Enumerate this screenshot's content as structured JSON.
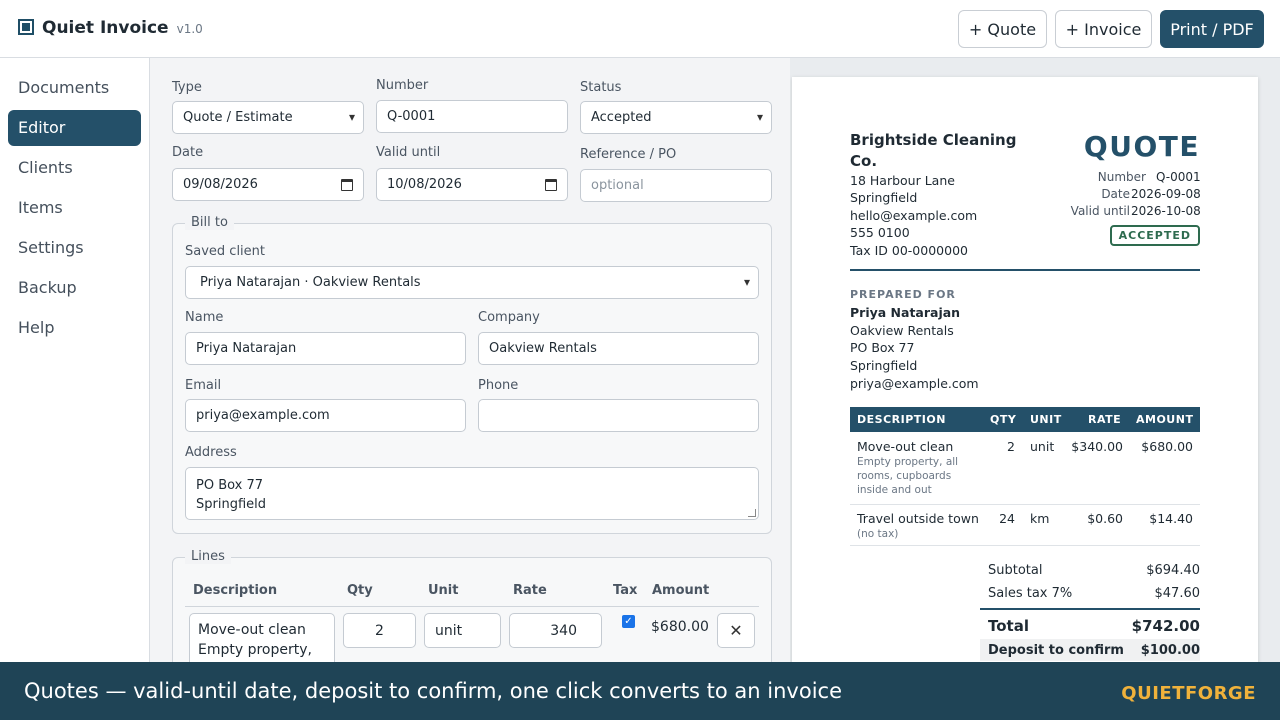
{
  "app": {
    "title": "Quiet Invoice",
    "version": "v1.0"
  },
  "header": {
    "new_quote": "+ Quote",
    "new_invoice": "+ Invoice",
    "print": "Print / PDF"
  },
  "sidebar": {
    "items": [
      {
        "label": "Documents",
        "active": false
      },
      {
        "label": "Editor",
        "active": true
      },
      {
        "label": "Clients",
        "active": false
      },
      {
        "label": "Items",
        "active": false
      },
      {
        "label": "Settings",
        "active": false
      },
      {
        "label": "Backup",
        "active": false
      },
      {
        "label": "Help",
        "active": false
      }
    ]
  },
  "editor": {
    "type_label": "Type",
    "type_value": "Quote / Estimate",
    "number_label": "Number",
    "number_value": "Q-0001",
    "status_label": "Status",
    "status_value": "Accepted",
    "date_label": "Date",
    "date_value": "09/08/2026",
    "valid_label": "Valid until",
    "valid_value": "10/08/2026",
    "ref_label": "Reference / PO",
    "ref_placeholder": "optional",
    "bill_to": {
      "legend": "Bill to",
      "saved_label": "Saved client",
      "saved_value": "Priya Natarajan · Oakview Rentals",
      "name_label": "Name",
      "name_value": "Priya Natarajan",
      "company_label": "Company",
      "company_value": "Oakview Rentals",
      "email_label": "Email",
      "email_value": "priya@example.com",
      "phone_label": "Phone",
      "phone_value": "",
      "address_label": "Address",
      "address_line1": "PO Box 77",
      "address_line2": "Springfield"
    },
    "lines": {
      "legend": "Lines",
      "columns": [
        "Description",
        "Qty",
        "Unit",
        "Rate",
        "Tax",
        "Amount"
      ],
      "rows": [
        {
          "desc1": "Move-out clean",
          "desc2": "Empty property,",
          "qty": "2",
          "unit": "unit",
          "rate": "340",
          "taxed": true,
          "amount": "$680.00"
        }
      ]
    }
  },
  "preview": {
    "company": "Brightside Cleaning Co.",
    "company_lines": [
      "18 Harbour Lane",
      "Springfield",
      "hello@example.com",
      "555 0100",
      "Tax ID 00-0000000"
    ],
    "doc_title": "QUOTE",
    "meta": [
      {
        "label": "Number",
        "value": "Q-0001"
      },
      {
        "label": "Date",
        "value": "2026-09-08"
      },
      {
        "label": "Valid until",
        "value": "2026-10-08"
      }
    ],
    "badge": "ACCEPTED",
    "prepared_for_label": "PREPARED FOR",
    "client_name": "Priya Natarajan",
    "client_lines": [
      "Oakview Rentals",
      "PO Box 77",
      "Springfield",
      "priya@example.com"
    ],
    "columns": [
      "DESCRIPTION",
      "QTY",
      "UNIT",
      "RATE",
      "AMOUNT"
    ],
    "items": [
      {
        "desc": "Move-out clean",
        "note": [
          "Empty property, all",
          "rooms, cupboards",
          "inside and out"
        ],
        "qty": "2",
        "unit": "unit",
        "rate": "$340.00",
        "amount": "$680.00"
      },
      {
        "desc": "Travel outside town",
        "note": [
          "(no tax)"
        ],
        "qty": "24",
        "unit": "km",
        "rate": "$0.60",
        "amount": "$14.40"
      }
    ],
    "subtotal_label": "Subtotal",
    "subtotal_value": "$694.40",
    "tax_label": "Sales tax 7%",
    "tax_value": "$47.60",
    "total_label": "Total",
    "total_value": "$742.00",
    "deposit_label": "Deposit to confirm",
    "deposit_value": "$100.00"
  },
  "footer": {
    "tagline": "Quotes — valid-until date, deposit to confirm, one click converts to an invoice",
    "brand": "QUIETFORGE"
  },
  "colors": {
    "primary": "#245069",
    "accepted": "#2e6b4f",
    "footer_bg": "#1f4456",
    "footer_brand": "#f0b23b"
  }
}
